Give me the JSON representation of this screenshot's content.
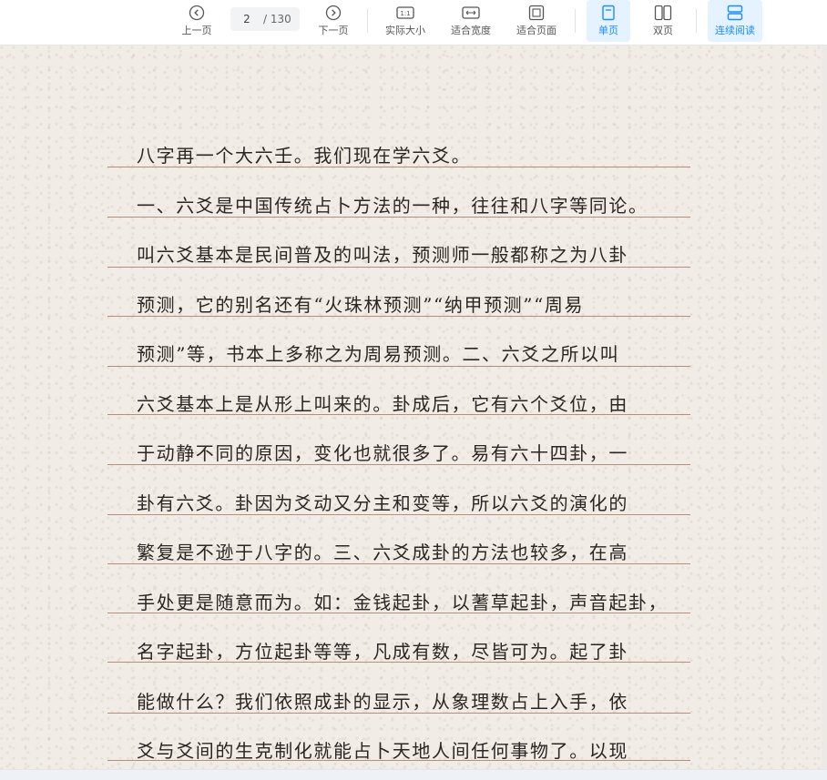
{
  "toolbar": {
    "prev_label": "上一页",
    "next_label": "下一页",
    "current_page": "2",
    "total_pages": "/ 130",
    "actual_size_label": "实际大小",
    "fit_width_label": "适合宽度",
    "fit_page_label": "适合页面",
    "single_page_label": "单页",
    "double_page_label": "双页",
    "continuous_label": "连续阅读",
    "accent_color": "#1a8cff"
  },
  "document": {
    "lines": [
      "八字再一个大六壬。我们现在学六爻。",
      "一、六爻是中国传统占卜方法的一种，往往和八字等同论。",
      "叫六爻基本是民间普及的叫法，预测师一般都称之为八卦",
      "预测，它的别名还有“火珠林预测”“纳甲预测”“周易",
      "预测”等，书本上多称之为周易预测。二、六爻之所以叫",
      "六爻基本上是从形上叫来的。卦成后，它有六个爻位，由",
      "于动静不同的原因，变化也就很多了。易有六十四卦，一",
      "卦有六爻。卦因为爻动又分主和变等，所以六爻的演化的",
      "繁复是不逊于八字的。三、六爻成卦的方法也较多，在高",
      "手处更是随意而为。如：金钱起卦，以蓍草起卦，声音起卦，",
      "名字起卦，方位起卦等等，凡成有数，尽皆可为。起了卦",
      "能做什么？我们依照成卦的显示，从象理数占上入手，依",
      "爻与爻间的生克制化就能占卜天地人间任何事物了。以现"
    ]
  }
}
